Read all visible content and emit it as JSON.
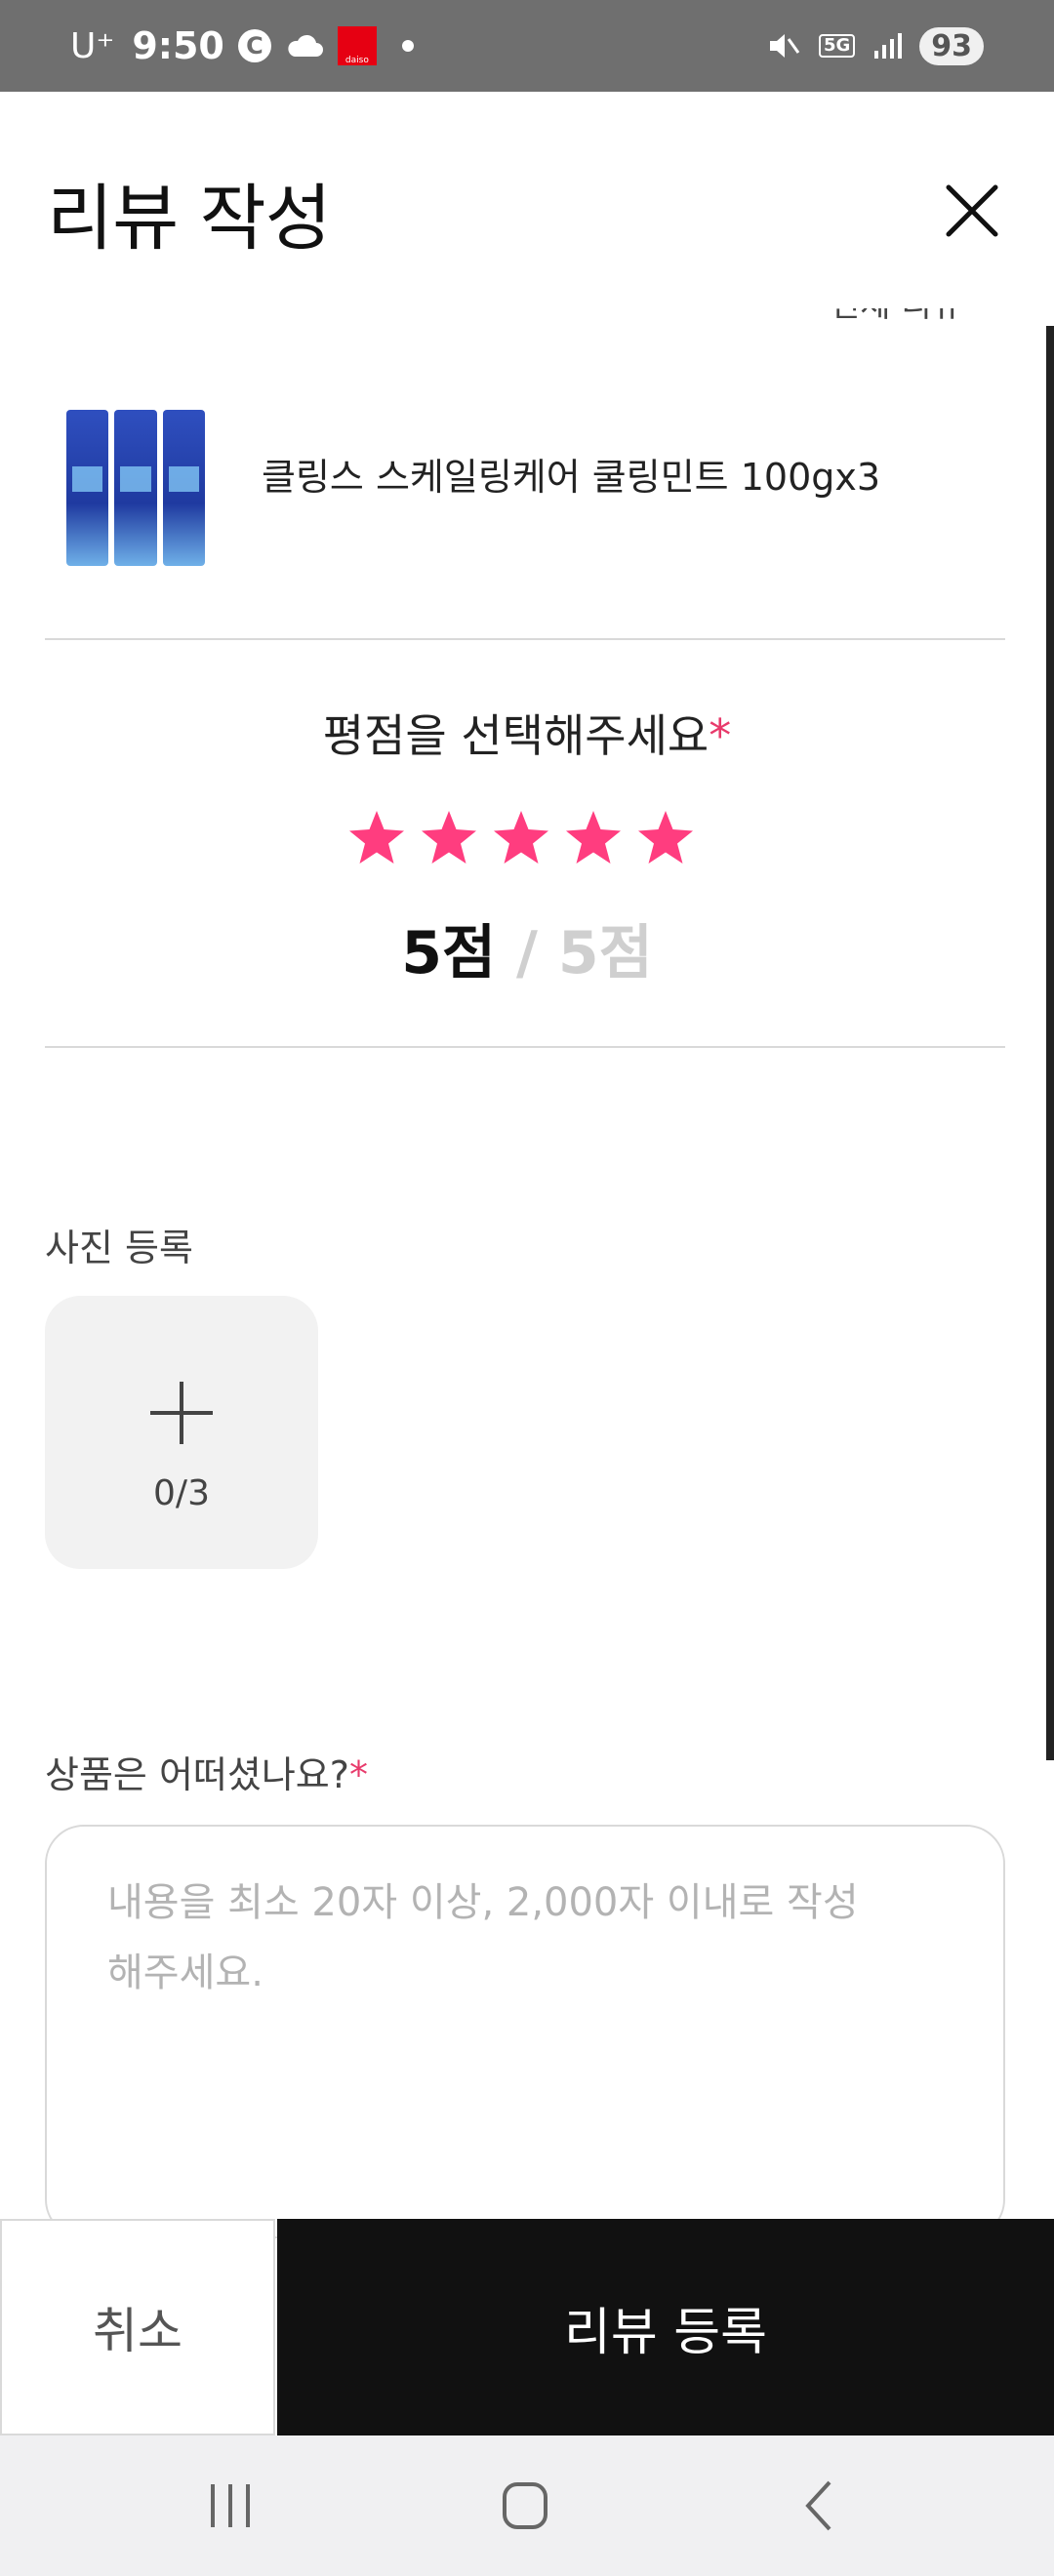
{
  "status_bar": {
    "carrier": "U⁺",
    "time": "9:50",
    "c_icon_text": "C",
    "daiso_text": "daiso",
    "network": "5G",
    "battery": "93"
  },
  "header": {
    "title": "리뷰 작성",
    "clipped_text": "전체 리뷰"
  },
  "product": {
    "name": "클링스 스케일링케어 쿨링민트 100gx3"
  },
  "rating": {
    "title": "평점을 선택해주세요",
    "required_mark": "*",
    "stars_selected": 5,
    "stars_total": 5,
    "score_current": "5점",
    "score_separator": " / ",
    "score_max": "5점",
    "star_color": "#ff3d7f"
  },
  "photo": {
    "label": "사진 등록",
    "count": "0/3"
  },
  "review": {
    "label": "상품은 어떠셨나요?",
    "required_mark": "*",
    "placeholder": "내용을 최소 20자 이상, 2,000자 이내로 작성해주세요."
  },
  "actions": {
    "cancel_label": "취소",
    "submit_label": "리뷰 등록"
  },
  "colors": {
    "accent": "#ff3d7f",
    "required": "#e83a6b",
    "dark": "#111111"
  }
}
